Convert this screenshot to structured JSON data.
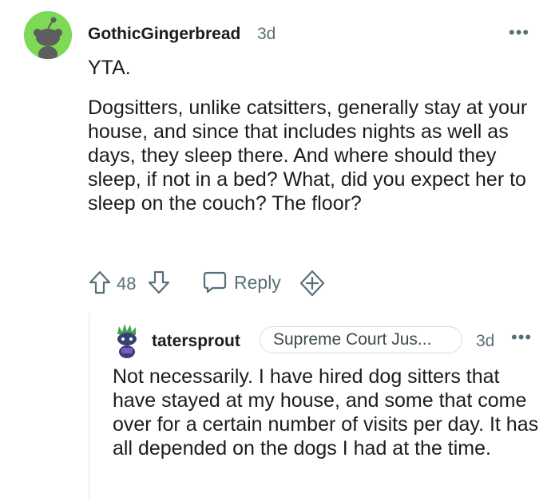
{
  "comment": {
    "author": "GothicGingerbread",
    "age": "3d",
    "more_icon": "more-horizontal-icon",
    "line1": "YTA.",
    "body": "Dogsitters, unlike catsitters, generally stay at your house, and since that includes nights as well as days, they sleep there. And where should they sleep, if not in a bed? What, did you expect her to sleep on the couch? The floor?",
    "score": "48",
    "reply_label": "Reply",
    "avatar_color": "#7ed957"
  },
  "reply": {
    "author": "tatersprout",
    "flair": "Supreme Court Jus...",
    "age": "3d",
    "body": "Not necessarily. I have hired dog sitters that have stayed at my house, and some that come over for a certain number of visits per day. It has all depended on the dogs I had at the time."
  },
  "colors": {
    "meta_gray": "#576f76",
    "text": "#1c1c1c",
    "thread_line": "#e5e7e8"
  }
}
